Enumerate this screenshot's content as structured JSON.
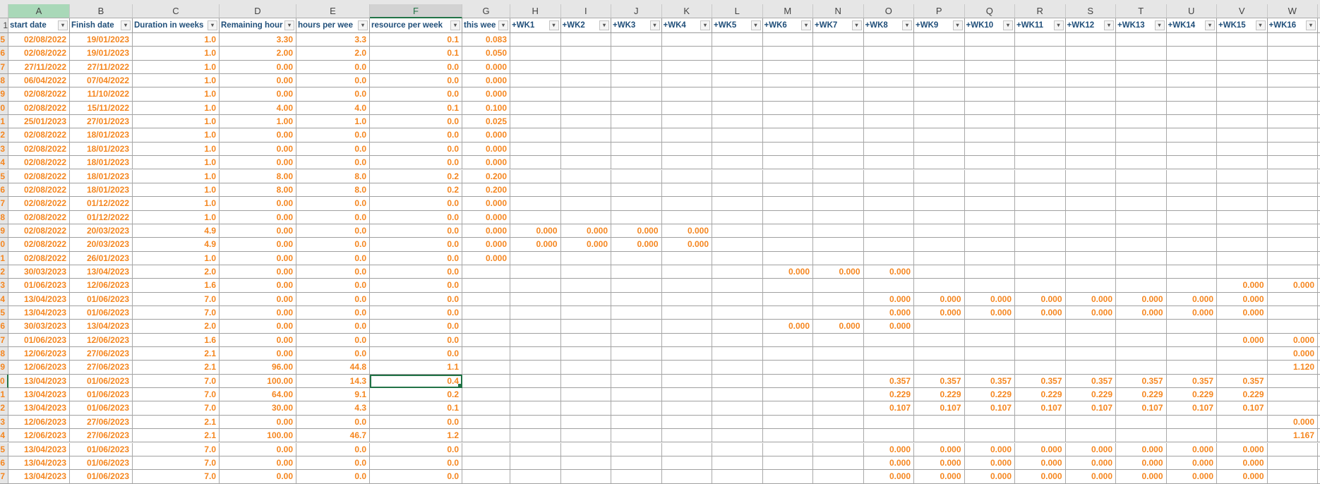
{
  "columns": {
    "letters": [
      "A",
      "B",
      "C",
      "D",
      "E",
      "F",
      "G",
      "H",
      "I",
      "J",
      "K",
      "L",
      "M",
      "N",
      "O",
      "P",
      "Q",
      "R",
      "S",
      "T",
      "U",
      "V",
      "W",
      ""
    ],
    "headers": [
      "start date",
      "Finish date",
      "Duration in weeks",
      "Remaining hour",
      "hours per wee",
      "resource per week",
      "this wee",
      "+WK1",
      "+WK2",
      "+WK3",
      "+WK4",
      "+WK5",
      "+WK6",
      "+WK7",
      "+WK8",
      "+WK9",
      "+WK10",
      "+WK11",
      "+WK12",
      "+WK13",
      "+WK14",
      "+WK15",
      "+WK16",
      "+"
    ]
  },
  "selection": {
    "column": "F",
    "row_index": 25
  },
  "colors": {
    "header_text": "#1f4e79",
    "value_text": "#f5861f",
    "selection": "#217346"
  },
  "rows": [
    {
      "rn": "5",
      "cells": [
        "02/08/2022",
        "19/01/2023",
        "1.0",
        "3.30",
        "3.3",
        "0.1",
        "0.083"
      ],
      "weeks": [
        "",
        "",
        "",
        "",
        "",
        "",
        "",
        "",
        "",
        "",
        "",
        "",
        "",
        "",
        "",
        ""
      ]
    },
    {
      "rn": "6",
      "cells": [
        "02/08/2022",
        "19/01/2023",
        "1.0",
        "2.00",
        "2.0",
        "0.1",
        "0.050"
      ],
      "weeks": [
        "",
        "",
        "",
        "",
        "",
        "",
        "",
        "",
        "",
        "",
        "",
        "",
        "",
        "",
        "",
        ""
      ]
    },
    {
      "rn": "7",
      "cells": [
        "27/11/2022",
        "27/11/2022",
        "1.0",
        "0.00",
        "0.0",
        "0.0",
        "0.000"
      ],
      "weeks": [
        "",
        "",
        "",
        "",
        "",
        "",
        "",
        "",
        "",
        "",
        "",
        "",
        "",
        "",
        "",
        ""
      ]
    },
    {
      "rn": "8",
      "cells": [
        "06/04/2022",
        "07/04/2022",
        "1.0",
        "0.00",
        "0.0",
        "0.0",
        "0.000"
      ],
      "weeks": [
        "",
        "",
        "",
        "",
        "",
        "",
        "",
        "",
        "",
        "",
        "",
        "",
        "",
        "",
        "",
        ""
      ]
    },
    {
      "rn": "9",
      "cells": [
        "02/08/2022",
        "11/10/2022",
        "1.0",
        "0.00",
        "0.0",
        "0.0",
        "0.000"
      ],
      "weeks": [
        "",
        "",
        "",
        "",
        "",
        "",
        "",
        "",
        "",
        "",
        "",
        "",
        "",
        "",
        "",
        ""
      ]
    },
    {
      "rn": "0",
      "cells": [
        "02/08/2022",
        "15/11/2022",
        "1.0",
        "4.00",
        "4.0",
        "0.1",
        "0.100"
      ],
      "weeks": [
        "",
        "",
        "",
        "",
        "",
        "",
        "",
        "",
        "",
        "",
        "",
        "",
        "",
        "",
        "",
        ""
      ]
    },
    {
      "rn": "1",
      "cells": [
        "25/01/2023",
        "27/01/2023",
        "1.0",
        "1.00",
        "1.0",
        "0.0",
        "0.025"
      ],
      "weeks": [
        "",
        "",
        "",
        "",
        "",
        "",
        "",
        "",
        "",
        "",
        "",
        "",
        "",
        "",
        "",
        ""
      ]
    },
    {
      "rn": "2",
      "cells": [
        "02/08/2022",
        "18/01/2023",
        "1.0",
        "0.00",
        "0.0",
        "0.0",
        "0.000"
      ],
      "weeks": [
        "",
        "",
        "",
        "",
        "",
        "",
        "",
        "",
        "",
        "",
        "",
        "",
        "",
        "",
        "",
        ""
      ]
    },
    {
      "rn": "3",
      "cells": [
        "02/08/2022",
        "18/01/2023",
        "1.0",
        "0.00",
        "0.0",
        "0.0",
        "0.000"
      ],
      "weeks": [
        "",
        "",
        "",
        "",
        "",
        "",
        "",
        "",
        "",
        "",
        "",
        "",
        "",
        "",
        "",
        ""
      ]
    },
    {
      "rn": "4",
      "cells": [
        "02/08/2022",
        "18/01/2023",
        "1.0",
        "0.00",
        "0.0",
        "0.0",
        "0.000"
      ],
      "weeks": [
        "",
        "",
        "",
        "",
        "",
        "",
        "",
        "",
        "",
        "",
        "",
        "",
        "",
        "",
        "",
        ""
      ]
    },
    {
      "rn": "5",
      "cells": [
        "02/08/2022",
        "18/01/2023",
        "1.0",
        "8.00",
        "8.0",
        "0.2",
        "0.200"
      ],
      "weeks": [
        "",
        "",
        "",
        "",
        "",
        "",
        "",
        "",
        "",
        "",
        "",
        "",
        "",
        "",
        "",
        ""
      ]
    },
    {
      "rn": "6",
      "cells": [
        "02/08/2022",
        "18/01/2023",
        "1.0",
        "8.00",
        "8.0",
        "0.2",
        "0.200"
      ],
      "weeks": [
        "",
        "",
        "",
        "",
        "",
        "",
        "",
        "",
        "",
        "",
        "",
        "",
        "",
        "",
        "",
        ""
      ]
    },
    {
      "rn": "7",
      "cells": [
        "02/08/2022",
        "01/12/2022",
        "1.0",
        "0.00",
        "0.0",
        "0.0",
        "0.000"
      ],
      "weeks": [
        "",
        "",
        "",
        "",
        "",
        "",
        "",
        "",
        "",
        "",
        "",
        "",
        "",
        "",
        "",
        ""
      ]
    },
    {
      "rn": "8",
      "cells": [
        "02/08/2022",
        "01/12/2022",
        "1.0",
        "0.00",
        "0.0",
        "0.0",
        "0.000"
      ],
      "weeks": [
        "",
        "",
        "",
        "",
        "",
        "",
        "",
        "",
        "",
        "",
        "",
        "",
        "",
        "",
        "",
        ""
      ]
    },
    {
      "rn": "9",
      "cells": [
        "02/08/2022",
        "20/03/2023",
        "4.9",
        "0.00",
        "0.0",
        "0.0",
        "0.000"
      ],
      "weeks": [
        "0.000",
        "0.000",
        "0.000",
        "0.000",
        "",
        "",
        "",
        "",
        "",
        "",
        "",
        "",
        "",
        "",
        "",
        ""
      ]
    },
    {
      "rn": "0",
      "cells": [
        "02/08/2022",
        "20/03/2023",
        "4.9",
        "0.00",
        "0.0",
        "0.0",
        "0.000"
      ],
      "weeks": [
        "0.000",
        "0.000",
        "0.000",
        "0.000",
        "",
        "",
        "",
        "",
        "",
        "",
        "",
        "",
        "",
        "",
        "",
        ""
      ]
    },
    {
      "rn": "1",
      "cells": [
        "02/08/2022",
        "26/01/2023",
        "1.0",
        "0.00",
        "0.0",
        "0.0",
        "0.000"
      ],
      "weeks": [
        "",
        "",
        "",
        "",
        "",
        "",
        "",
        "",
        "",
        "",
        "",
        "",
        "",
        "",
        "",
        ""
      ]
    },
    {
      "rn": "2",
      "cells": [
        "30/03/2023",
        "13/04/2023",
        "2.0",
        "0.00",
        "0.0",
        "0.0",
        ""
      ],
      "weeks": [
        "",
        "",
        "",
        "",
        "",
        "0.000",
        "0.000",
        "0.000",
        "",
        "",
        "",
        "",
        "",
        "",
        "",
        ""
      ]
    },
    {
      "rn": "3",
      "cells": [
        "01/06/2023",
        "12/06/2023",
        "1.6",
        "0.00",
        "0.0",
        "0.0",
        ""
      ],
      "weeks": [
        "",
        "",
        "",
        "",
        "",
        "",
        "",
        "",
        "",
        "",
        "",
        "",
        "",
        "",
        "0.000",
        "0.000"
      ]
    },
    {
      "rn": "4",
      "cells": [
        "13/04/2023",
        "01/06/2023",
        "7.0",
        "0.00",
        "0.0",
        "0.0",
        ""
      ],
      "weeks": [
        "",
        "",
        "",
        "",
        "",
        "",
        "",
        "0.000",
        "0.000",
        "0.000",
        "0.000",
        "0.000",
        "0.000",
        "0.000",
        "0.000",
        ""
      ]
    },
    {
      "rn": "5",
      "cells": [
        "13/04/2023",
        "01/06/2023",
        "7.0",
        "0.00",
        "0.0",
        "0.0",
        ""
      ],
      "weeks": [
        "",
        "",
        "",
        "",
        "",
        "",
        "",
        "0.000",
        "0.000",
        "0.000",
        "0.000",
        "0.000",
        "0.000",
        "0.000",
        "0.000",
        ""
      ]
    },
    {
      "rn": "6",
      "cells": [
        "30/03/2023",
        "13/04/2023",
        "2.0",
        "0.00",
        "0.0",
        "0.0",
        ""
      ],
      "weeks": [
        "",
        "",
        "",
        "",
        "",
        "0.000",
        "0.000",
        "0.000",
        "",
        "",
        "",
        "",
        "",
        "",
        "",
        ""
      ]
    },
    {
      "rn": "7",
      "cells": [
        "01/06/2023",
        "12/06/2023",
        "1.6",
        "0.00",
        "0.0",
        "0.0",
        ""
      ],
      "weeks": [
        "",
        "",
        "",
        "",
        "",
        "",
        "",
        "",
        "",
        "",
        "",
        "",
        "",
        "",
        "0.000",
        "0.000"
      ]
    },
    {
      "rn": "8",
      "cells": [
        "12/06/2023",
        "27/06/2023",
        "2.1",
        "0.00",
        "0.0",
        "0.0",
        ""
      ],
      "weeks": [
        "",
        "",
        "",
        "",
        "",
        "",
        "",
        "",
        "",
        "",
        "",
        "",
        "",
        "",
        "",
        "0.000"
      ]
    },
    {
      "rn": "9",
      "cells": [
        "12/06/2023",
        "27/06/2023",
        "2.1",
        "96.00",
        "44.8",
        "1.1",
        ""
      ],
      "weeks": [
        "",
        "",
        "",
        "",
        "",
        "",
        "",
        "",
        "",
        "",
        "",
        "",
        "",
        "",
        "",
        "1.120"
      ]
    },
    {
      "rn": "0",
      "cells": [
        "13/04/2023",
        "01/06/2023",
        "7.0",
        "100.00",
        "14.3",
        "0.4",
        ""
      ],
      "weeks": [
        "",
        "",
        "",
        "",
        "",
        "",
        "",
        "0.357",
        "0.357",
        "0.357",
        "0.357",
        "0.357",
        "0.357",
        "0.357",
        "0.357",
        ""
      ]
    },
    {
      "rn": "1",
      "cells": [
        "13/04/2023",
        "01/06/2023",
        "7.0",
        "64.00",
        "9.1",
        "0.2",
        ""
      ],
      "weeks": [
        "",
        "",
        "",
        "",
        "",
        "",
        "",
        "0.229",
        "0.229",
        "0.229",
        "0.229",
        "0.229",
        "0.229",
        "0.229",
        "0.229",
        ""
      ]
    },
    {
      "rn": "2",
      "cells": [
        "13/04/2023",
        "01/06/2023",
        "7.0",
        "30.00",
        "4.3",
        "0.1",
        ""
      ],
      "weeks": [
        "",
        "",
        "",
        "",
        "",
        "",
        "",
        "0.107",
        "0.107",
        "0.107",
        "0.107",
        "0.107",
        "0.107",
        "0.107",
        "0.107",
        ""
      ]
    },
    {
      "rn": "3",
      "cells": [
        "12/06/2023",
        "27/06/2023",
        "2.1",
        "0.00",
        "0.0",
        "0.0",
        ""
      ],
      "weeks": [
        "",
        "",
        "",
        "",
        "",
        "",
        "",
        "",
        "",
        "",
        "",
        "",
        "",
        "",
        "",
        "0.000"
      ]
    },
    {
      "rn": "4",
      "cells": [
        "12/06/2023",
        "27/06/2023",
        "2.1",
        "100.00",
        "46.7",
        "1.2",
        ""
      ],
      "weeks": [
        "",
        "",
        "",
        "",
        "",
        "",
        "",
        "",
        "",
        "",
        "",
        "",
        "",
        "",
        "",
        "1.167"
      ]
    },
    {
      "rn": "5",
      "cells": [
        "13/04/2023",
        "01/06/2023",
        "7.0",
        "0.00",
        "0.0",
        "0.0",
        ""
      ],
      "weeks": [
        "",
        "",
        "",
        "",
        "",
        "",
        "",
        "0.000",
        "0.000",
        "0.000",
        "0.000",
        "0.000",
        "0.000",
        "0.000",
        "0.000",
        ""
      ]
    },
    {
      "rn": "6",
      "cells": [
        "13/04/2023",
        "01/06/2023",
        "7.0",
        "0.00",
        "0.0",
        "0.0",
        ""
      ],
      "weeks": [
        "",
        "",
        "",
        "",
        "",
        "",
        "",
        "0.000",
        "0.000",
        "0.000",
        "0.000",
        "0.000",
        "0.000",
        "0.000",
        "0.000",
        ""
      ]
    },
    {
      "rn": "7",
      "cells": [
        "13/04/2023",
        "01/06/2023",
        "7.0",
        "0.00",
        "0.0",
        "0.0",
        ""
      ],
      "weeks": [
        "",
        "",
        "",
        "",
        "",
        "",
        "",
        "0.000",
        "0.000",
        "0.000",
        "0.000",
        "0.000",
        "0.000",
        "0.000",
        "0.000",
        ""
      ]
    }
  ]
}
